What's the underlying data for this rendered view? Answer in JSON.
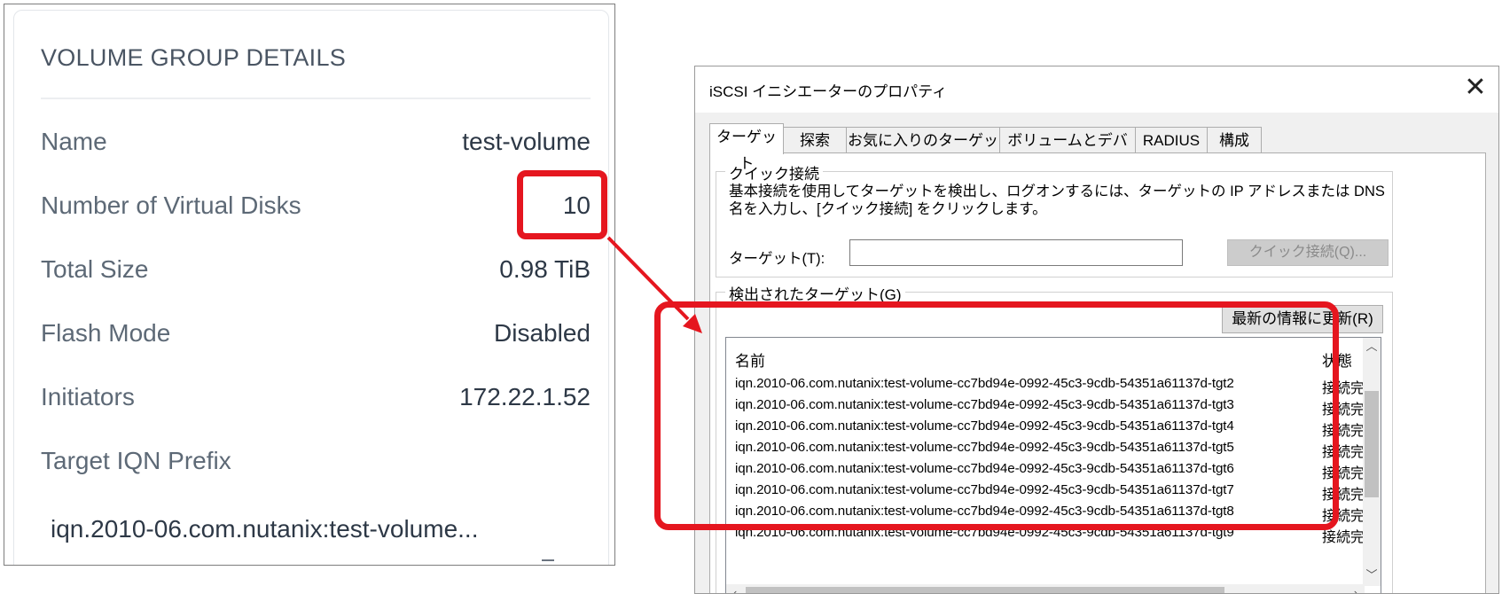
{
  "volume_group": {
    "title": "VOLUME GROUP DETAILS",
    "rows": [
      {
        "label": "Name",
        "value": "test-volume"
      },
      {
        "label": "Number of Virtual Disks",
        "value": "10"
      },
      {
        "label": "Total Size",
        "value": "0.98 TiB"
      },
      {
        "label": "Flash Mode",
        "value": "Disabled"
      },
      {
        "label": "Initiators",
        "value": "172.22.1.52"
      }
    ],
    "target_iqn_label": "Target IQN Prefix",
    "target_iqn_value": "iqn.2010-06.com.nutanix:test-volume..."
  },
  "dialog": {
    "title": "iSCSI イニシエーターのプロパティ",
    "close_glyph": "✕",
    "tabs": [
      "ターゲット",
      "探索",
      "お気に入りのターゲット",
      "ボリュームとデバイス",
      "RADIUS",
      "構成"
    ],
    "quick_connect": {
      "legend": "クイック接続",
      "description": "基本接続を使用してターゲットを検出し、ログオンするには、ターゲットの IP アドレスまたは DNS 名を入力し、[クイック接続] をクリックします。",
      "target_label": "ターゲット(T):",
      "target_value": "",
      "button": "クイック接続(Q)..."
    },
    "discovered": {
      "legend": "検出されたターゲット(G)",
      "refresh_button": "最新の情報に更新(R)",
      "columns": {
        "name": "名前",
        "status": "状態"
      },
      "rows": [
        {
          "name": "iqn.2010-06.com.nutanix:test-volume-cc7bd94e-0992-45c3-9cdb-54351a61137d-tgt2",
          "status": "接続完"
        },
        {
          "name": "iqn.2010-06.com.nutanix:test-volume-cc7bd94e-0992-45c3-9cdb-54351a61137d-tgt3",
          "status": "接続完"
        },
        {
          "name": "iqn.2010-06.com.nutanix:test-volume-cc7bd94e-0992-45c3-9cdb-54351a61137d-tgt4",
          "status": "接続完"
        },
        {
          "name": "iqn.2010-06.com.nutanix:test-volume-cc7bd94e-0992-45c3-9cdb-54351a61137d-tgt5",
          "status": "接続完"
        },
        {
          "name": "iqn.2010-06.com.nutanix:test-volume-cc7bd94e-0992-45c3-9cdb-54351a61137d-tgt6",
          "status": "接続完"
        },
        {
          "name": "iqn.2010-06.com.nutanix:test-volume-cc7bd94e-0992-45c3-9cdb-54351a61137d-tgt7",
          "status": "接続完"
        },
        {
          "name": "iqn.2010-06.com.nutanix:test-volume-cc7bd94e-0992-45c3-9cdb-54351a61137d-tgt8",
          "status": "接続完"
        },
        {
          "name": "iqn.2010-06.com.nutanix:test-volume-cc7bd94e-0992-45c3-9cdb-54351a61137d-tgt9",
          "status": "接続完"
        }
      ]
    }
  },
  "highlight_color": "#e5161f"
}
